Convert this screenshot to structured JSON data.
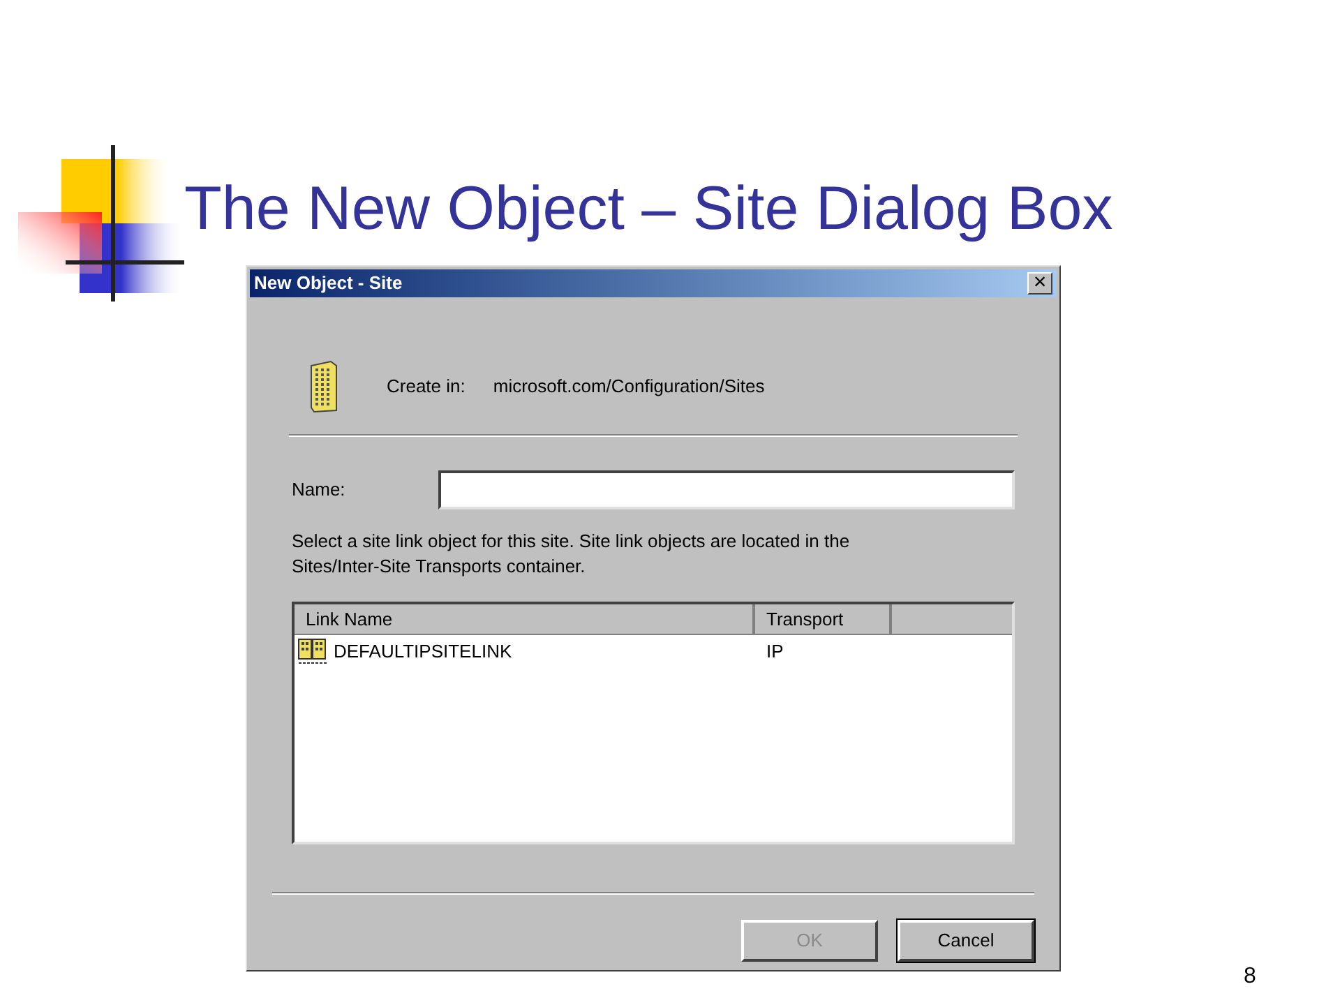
{
  "slide": {
    "title": "The New Object – Site Dialog Box",
    "page_number": "8"
  },
  "dialog": {
    "title": "New Object - Site",
    "close": "×",
    "create_in": {
      "label": "Create in:",
      "value": "microsoft.com/Configuration/Sites"
    },
    "name_field": {
      "label": "Name:"
    },
    "instructions": "Select a site link object for this site. Site link objects are located in the Sites/Inter-Site Transports container.",
    "table": {
      "columns": [
        "Link Name",
        "Transport"
      ],
      "rows": [
        {
          "cells": [
            "DEFAULTIPSITELINK",
            "IP"
          ],
          "selected": false
        }
      ]
    },
    "buttons": [
      {
        "label": "OK",
        "disabled": true
      },
      {
        "label": "Cancel",
        "disabled": false
      }
    ]
  }
}
